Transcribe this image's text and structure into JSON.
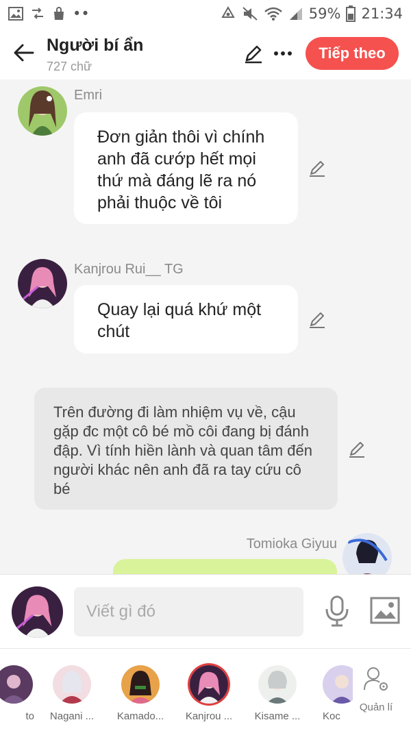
{
  "status_bar": {
    "battery": "59%",
    "time": "21:34",
    "dots": "••"
  },
  "header": {
    "title": "Người bí ẩn",
    "subtitle": "727 chữ",
    "next_label": "Tiếp theo"
  },
  "messages": [
    {
      "type": "character",
      "name": "Emri",
      "text": "Đơn giản thôi vì chính anh đã cướp hết mọi thứ mà đáng lẽ ra nó phải thuộc về tôi"
    },
    {
      "type": "character",
      "name": "Kanjrou Rui__ TG",
      "text": "Quay lại quá khứ một chút"
    },
    {
      "type": "narration",
      "text": "Trên đường đi làm nhiệm vụ về, cậu gặp đc một cô bé mồ côi đang bị đánh đập. Vì tính hiền lành và quan tâm đến người khác nên anh đã ra tay cứu cô bé"
    },
    {
      "type": "character_right",
      "name": "Tomioka Giyuu",
      "text": ""
    }
  ],
  "composer": {
    "placeholder": "Viết gì đó"
  },
  "characters": [
    {
      "name": "to"
    },
    {
      "name": "Nagani ..."
    },
    {
      "name": "Kamado..."
    },
    {
      "name": "Kanjrou ..."
    },
    {
      "name": "Kisame ..."
    },
    {
      "name": "Koc"
    }
  ],
  "manage_label": "Quản lí",
  "colors": {
    "accent": "#f5514f",
    "bubble_right": "#d9f39a",
    "narration_bg": "#e8e8e8"
  },
  "icons": [
    "image-icon",
    "transfer-icon",
    "bag-icon",
    "recycle-icon",
    "mute-icon",
    "wifi-icon",
    "signal-icon",
    "battery-icon",
    "back-arrow-icon",
    "pencil-icon",
    "more-icon",
    "mic-icon",
    "gallery-icon",
    "manage-user-icon"
  ]
}
